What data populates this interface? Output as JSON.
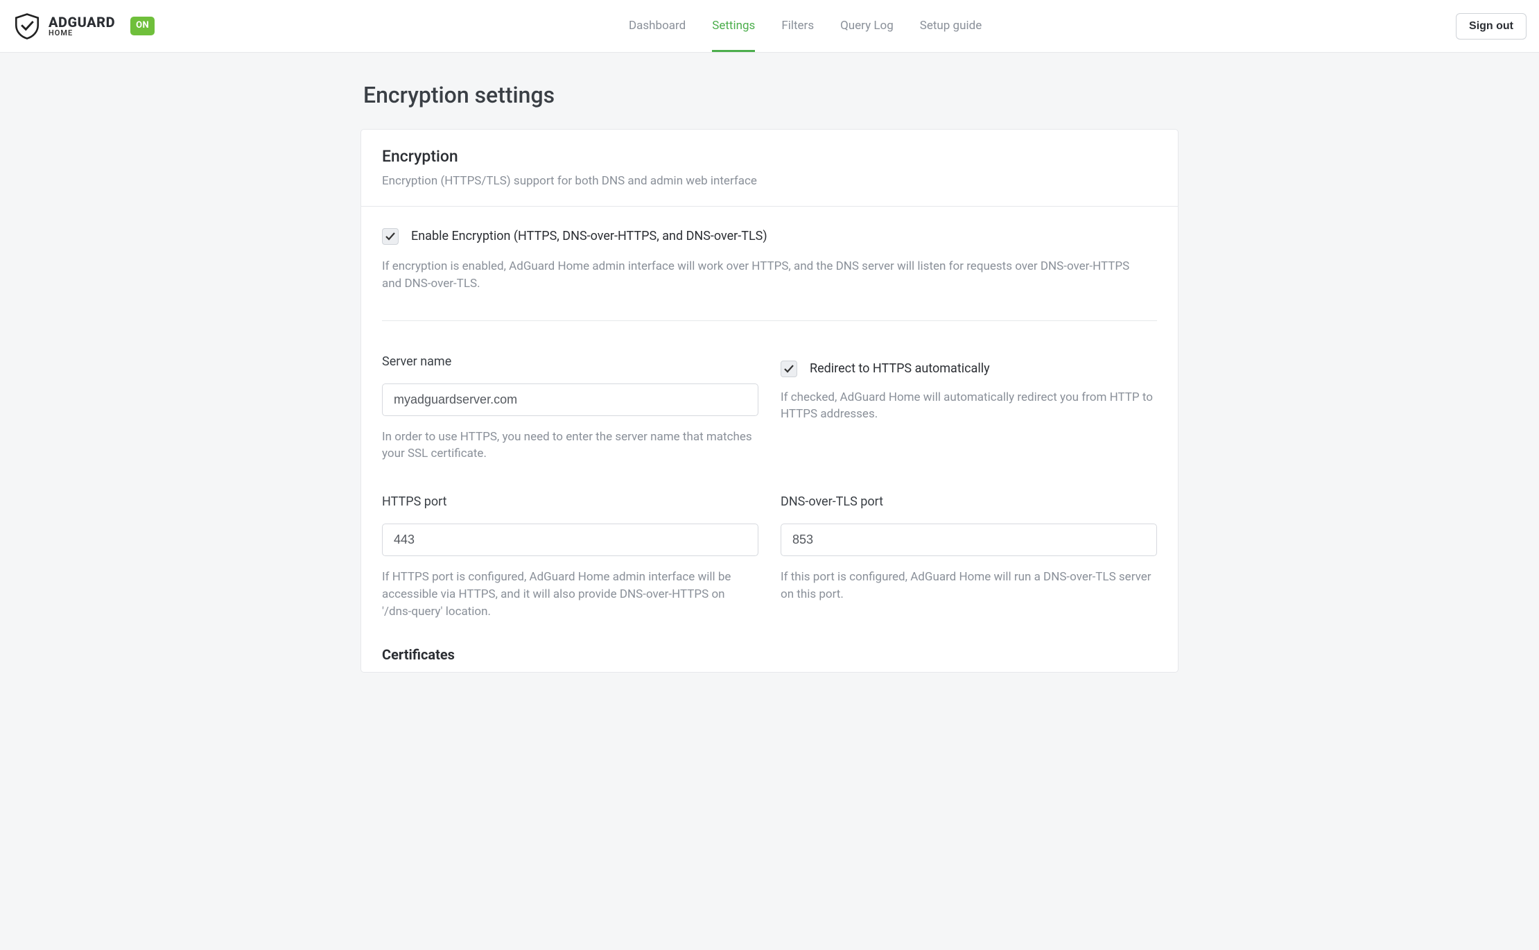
{
  "brand": {
    "name": "ADGUARD",
    "sub": "HOME",
    "status": "ON"
  },
  "nav": {
    "dashboard": "Dashboard",
    "settings": "Settings",
    "filters": "Filters",
    "querylog": "Query Log",
    "setupguide": "Setup guide"
  },
  "signout": "Sign out",
  "page": {
    "title": "Encryption settings"
  },
  "card": {
    "title": "Encryption",
    "subtitle": "Encryption (HTTPS/TLS) support for both DNS and admin web interface"
  },
  "enable": {
    "label": "Enable Encryption (HTTPS, DNS-over-HTTPS, and DNS-over-TLS)",
    "help": "If encryption is enabled, AdGuard Home admin interface will work over HTTPS, and the DNS server will listen for requests over DNS-over-HTTPS and DNS-over-TLS."
  },
  "server_name": {
    "label": "Server name",
    "value": "myadguardserver.com",
    "help": "In order to use HTTPS, you need to enter the server name that matches your SSL certificate."
  },
  "redirect": {
    "label": "Redirect to HTTPS automatically",
    "help": "If checked, AdGuard Home will automatically redirect you from HTTP to HTTPS addresses."
  },
  "https_port": {
    "label": "HTTPS port",
    "value": "443",
    "help": "If HTTPS port is configured, AdGuard Home admin interface will be accessible via HTTPS, and it will also provide DNS-over-HTTPS on '/dns-query' location."
  },
  "dot_port": {
    "label": "DNS-over-TLS port",
    "value": "853",
    "help": "If this port is configured, AdGuard Home will run a DNS-over-TLS server on this port."
  },
  "certificates": {
    "heading": "Certificates"
  }
}
